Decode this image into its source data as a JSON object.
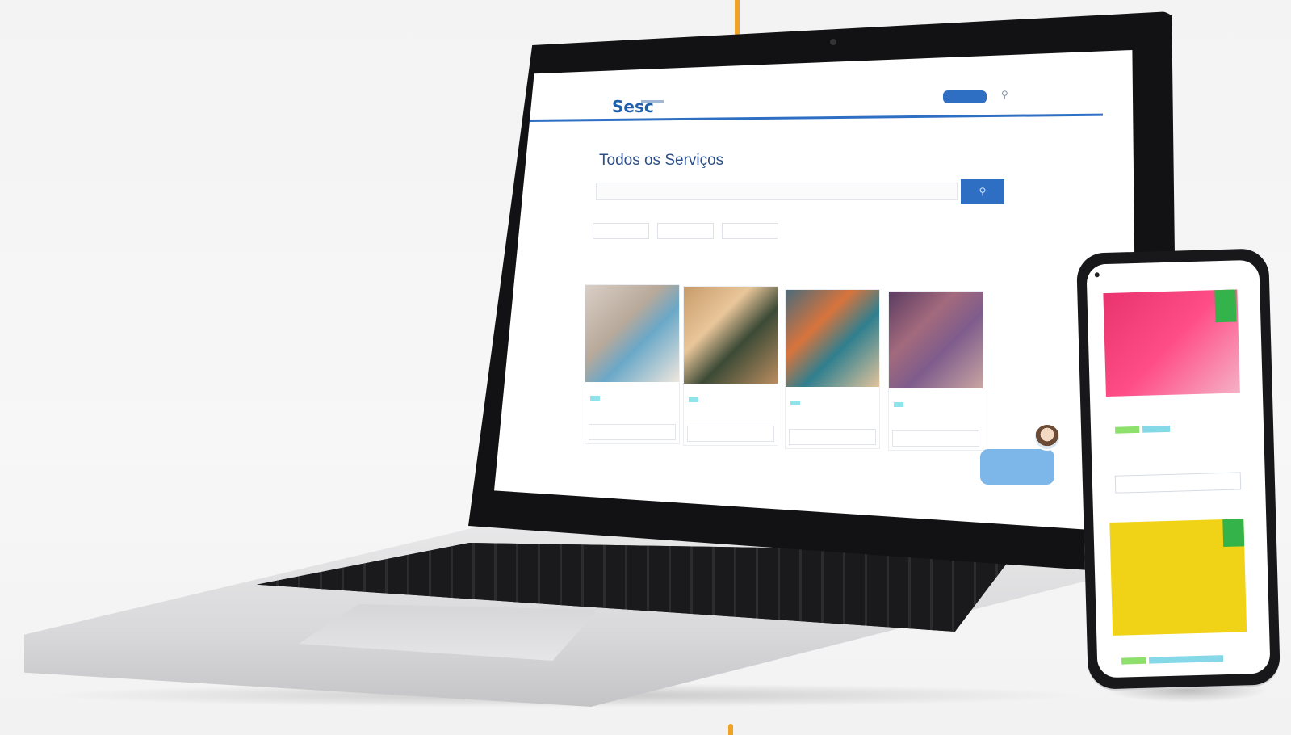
{
  "colors": {
    "accent_orange": "#f0a224",
    "brand_blue": "#2e6fc4",
    "title_blue": "#2d4f86",
    "badge_cyan": "#8fe3ea",
    "badge_green": "#34b34a",
    "phone_card1": "#e8336e",
    "phone_card2": "#f0d316"
  },
  "laptop": {
    "nav": {
      "logo": "Sesc",
      "links": [
        "",
        "",
        "",
        "",
        "",
        "",
        "",
        ""
      ],
      "cta": "",
      "search_icon": "search-icon"
    },
    "page_title": "Todos os Serviços",
    "search": {
      "placeholder": ""
    },
    "filters": [
      "",
      "",
      ""
    ],
    "checkboxes": [
      "",
      "",
      ""
    ],
    "cards": [
      {
        "title": "",
        "badge": "",
        "subtitle": "",
        "button": ""
      },
      {
        "title": "",
        "badge": "",
        "subtitle": "",
        "button": ""
      },
      {
        "title": "",
        "badge": "",
        "subtitle": "",
        "button": ""
      },
      {
        "title": "",
        "badge": "",
        "subtitle": "",
        "button": ""
      }
    ],
    "chat": {
      "text": ""
    }
  },
  "phone": {
    "cards": [
      {
        "title": "",
        "button": ""
      },
      {
        "title": ""
      }
    ]
  }
}
